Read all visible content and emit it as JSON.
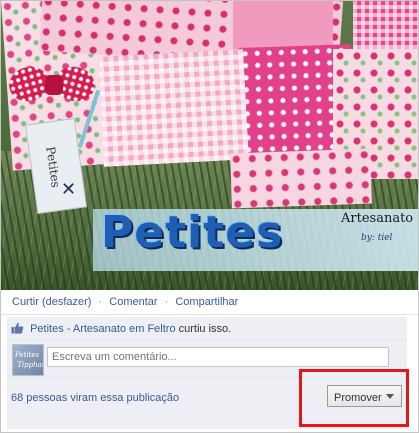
{
  "photo": {
    "tag_text": "Petites",
    "banner_title": "Petites",
    "banner_side": "Artesanato",
    "banner_by": "by: tiel"
  },
  "actions": {
    "unlike": "Curtir (desfazer)",
    "separator": "·",
    "comment": "Comentar",
    "share": "Compartilhar"
  },
  "likes": {
    "page_name": "Petites - Artesanato em Feltro",
    "suffix": " curtiu isso."
  },
  "comment_box": {
    "placeholder": "Escreva um comentário...",
    "avatar_text": "Petites Tipphanni"
  },
  "footer": {
    "views": "68 pessoas viram essa publicação",
    "promote_label": "Promover"
  },
  "colors": {
    "link": "#3b5998",
    "highlight": "#e5161b"
  },
  "icons": {
    "like": "thumbs-up-icon",
    "dropdown": "chevron-down-icon"
  }
}
